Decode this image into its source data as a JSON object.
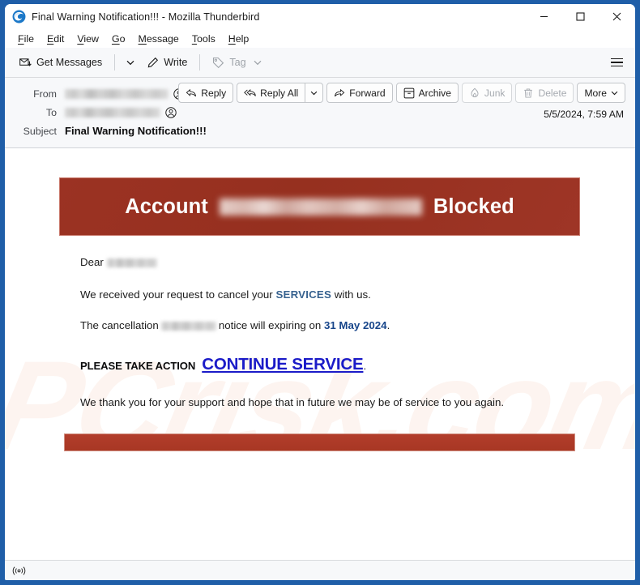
{
  "window": {
    "title": "Final Warning Notification!!! - Mozilla Thunderbird",
    "logo_icon": "thunderbird-logo-icon",
    "controls": {
      "minimize": "minimize-icon",
      "maximize": "maximize-icon",
      "close": "close-icon"
    },
    "frame_color": "#1f5ea8"
  },
  "menubar": {
    "items": [
      {
        "label": "File",
        "accesskey": "F"
      },
      {
        "label": "Edit",
        "accesskey": "E"
      },
      {
        "label": "View",
        "accesskey": "V"
      },
      {
        "label": "Go",
        "accesskey": "G"
      },
      {
        "label": "Message",
        "accesskey": "M"
      },
      {
        "label": "Tools",
        "accesskey": "T"
      },
      {
        "label": "Help",
        "accesskey": "H"
      }
    ]
  },
  "toolbar": {
    "get_messages_label": "Get Messages",
    "get_messages_icon": "envelope-download-icon",
    "get_messages_caret_icon": "chevron-down-icon",
    "write_label": "Write",
    "write_icon": "pencil-icon",
    "tag_label": "Tag",
    "tag_icon": "tag-icon",
    "tag_caret_icon": "chevron-down-icon",
    "tag_disabled": true,
    "app_menu_icon": "hamburger-menu-icon"
  },
  "message_header": {
    "from_label": "From",
    "from_value": "",
    "from_avatar_icon": "contact-avatar-icon",
    "to_label": "To",
    "to_value": "",
    "to_avatar_icon": "contact-avatar-icon",
    "subject_label": "Subject",
    "subject_value": "Final Warning Notification!!!",
    "date": "5/5/2024, 7:59 AM",
    "actions": [
      {
        "label": "Reply",
        "icon": "reply-icon",
        "disabled": false
      },
      {
        "label": "Reply All",
        "icon": "reply-all-icon",
        "disabled": false
      },
      {
        "label": "Forward",
        "icon": "forward-icon",
        "disabled": false
      },
      {
        "label": "Archive",
        "icon": "archive-box-icon",
        "disabled": false
      },
      {
        "label": "Junk",
        "icon": "junk-flame-icon",
        "disabled": true
      },
      {
        "label": "Delete",
        "icon": "trash-icon",
        "disabled": true
      },
      {
        "label": "More",
        "icon": "chevron-down-icon",
        "disabled": false
      }
    ]
  },
  "email": {
    "watermark_text": "PCrisk.com",
    "banner": {
      "text_before": "Account",
      "text_after": "Blocked",
      "redacted_middle": "",
      "background_color": "#9b3223",
      "text_color": "#ffffff"
    },
    "greeting_label": "Dear",
    "greeting_name": "",
    "line_request_before": "We received your request to cancel your",
    "line_request_keyword": "SERVICES",
    "line_request_after": "with us.",
    "services_color": "#37628f",
    "line_cancel_before": "The cancellation",
    "line_cancel_redacted": "",
    "line_cancel_mid": "notice will expiring on",
    "line_cancel_date": "31 May 2024",
    "line_cancel_period": ".",
    "date_color": "#17458a",
    "action_label": "PLEASE TAKE ACTION",
    "cta_label": "CONTINUE SERVICE",
    "cta_period": ".",
    "cta_color": "#1b1bc8",
    "line_thanks": "We thank you for your support and hope that in future we may be of service to you again.",
    "footer_bar_color": "#b23d2b"
  },
  "statusbar": {
    "online_icon": "online-broadcast-icon",
    "text": ""
  }
}
